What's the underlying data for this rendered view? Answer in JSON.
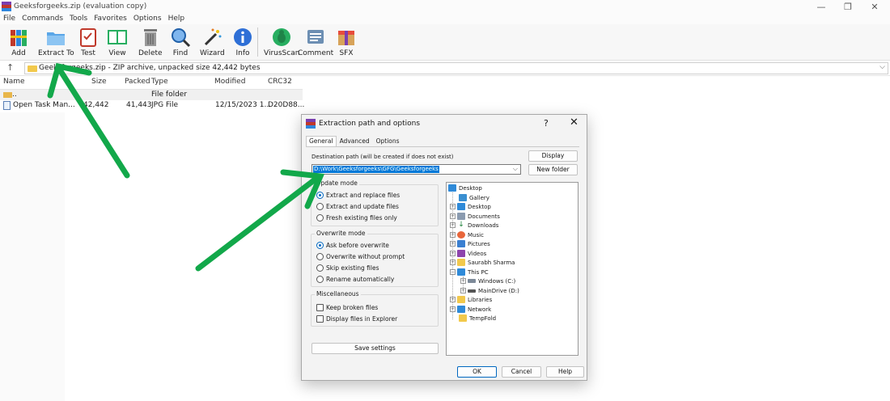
{
  "window": {
    "title": "Geeksforgeeks.zip (evaluation copy)",
    "controls": [
      "—",
      "❐",
      "✕"
    ]
  },
  "menu": [
    "File",
    "Commands",
    "Tools",
    "Favorites",
    "Options",
    "Help"
  ],
  "toolbar": {
    "add": "Add",
    "extract_to": "Extract To",
    "test": "Test",
    "view": "View",
    "delete": "Delete",
    "find": "Find",
    "wizard": "Wizard",
    "info": "Info",
    "virusscan": "VirusScan",
    "comment": "Comment",
    "sfx": "SFX"
  },
  "address": {
    "up": "↑",
    "path": "Geeksforgeeks.zip - ZIP archive, unpacked size 42,442 bytes",
    "dropdown": "⌵"
  },
  "file_list": {
    "columns": {
      "name": "Name",
      "size": "Size",
      "packed": "Packed",
      "type": "Type",
      "modified": "Modified",
      "crc": "CRC32"
    },
    "rows": [
      {
        "name": "..",
        "size": "",
        "packed": "",
        "type": "File folder",
        "modified": "",
        "crc": ""
      },
      {
        "name": "Open Task Man...",
        "size": "42,442",
        "packed": "41,443",
        "type": "JPG File",
        "modified": "12/15/2023 1...",
        "crc": "D20D88..."
      }
    ]
  },
  "dialog": {
    "title": "Extraction path and options",
    "help": "?",
    "close": "✕",
    "tabs": [
      "General",
      "Advanced",
      "Options"
    ],
    "dest_label": "Destination path (will be created if does not exist)",
    "dest_value": "D:\\Work\\Geeksforgeeks\\GFG\\Geeksforgeeks",
    "display_btn": "Display",
    "new_folder_btn": "New folder",
    "update_mode": {
      "title": "Update mode",
      "options": [
        "Extract and replace files",
        "Extract and update files",
        "Fresh existing files only"
      ],
      "selected": 0
    },
    "overwrite_mode": {
      "title": "Overwrite mode",
      "options": [
        "Ask before overwrite",
        "Overwrite without prompt",
        "Skip existing files",
        "Rename automatically"
      ],
      "selected": 0
    },
    "misc": {
      "title": "Miscellaneous",
      "options": [
        "Keep broken files",
        "Display files in Explorer"
      ]
    },
    "save_settings": "Save settings",
    "tree": [
      "Desktop",
      "Gallery",
      "Desktop",
      "Documents",
      "Downloads",
      "Music",
      "Pictures",
      "Videos",
      "Saurabh Sharma",
      "This PC",
      "Windows (C:)",
      "MainDrive (D:)",
      "Libraries",
      "Network",
      "TempFold"
    ],
    "ok": "OK",
    "cancel": "Cancel",
    "help_btn": "Help"
  },
  "colors": {
    "accent": "#0067c0",
    "selection": "#0078d7",
    "arrow": "#12a84a"
  }
}
